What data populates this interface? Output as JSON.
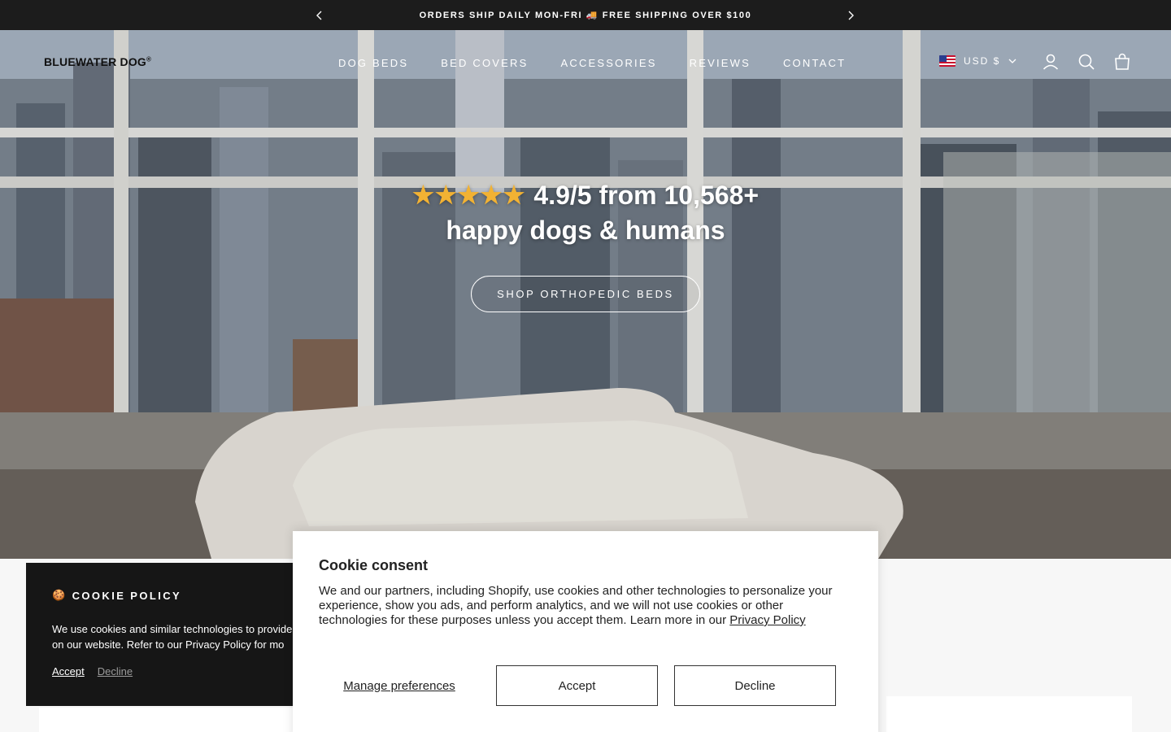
{
  "announcement": {
    "text": "ORDERS SHIP DAILY MON-FRI 🚚 FREE SHIPPING OVER $100"
  },
  "header": {
    "logo": "BLUEWATER DOG",
    "logo_mark": "®",
    "nav": [
      "DOG BEDS",
      "BED COVERS",
      "ACCESSORIES",
      "REVIEWS",
      "CONTACT"
    ],
    "currency": "USD $",
    "icons": [
      "account-icon",
      "search-icon",
      "cart-icon"
    ]
  },
  "hero": {
    "stars": "★★★★★",
    "rating_text": "4.9/5 from 10,568+",
    "line2": "happy dogs & humans",
    "cta": "SHOP ORTHOPEDIC BEDS"
  },
  "cookie_policy": {
    "title": "COOKIE POLICY",
    "icon": "🍪",
    "text_line1": "We use cookies and similar technologies to provide",
    "text_line2": "on our website. Refer to our Privacy Policy for mo",
    "accept": "Accept",
    "decline": "Decline"
  },
  "consent": {
    "title": "Cookie consent",
    "text": "We and our partners, including Shopify, use cookies and other technologies to personalize your experience, show you ads, and perform analytics, and we will not use cookies or other technologies for these purposes unless you accept them. Learn more in our",
    "link": "Privacy Policy",
    "manage": "Manage preferences",
    "accept": "Accept",
    "decline": "Decline"
  },
  "colors": {
    "announce_bg": "#1c1c1c",
    "star": "#f2b233",
    "dark_banner": "#161616"
  }
}
